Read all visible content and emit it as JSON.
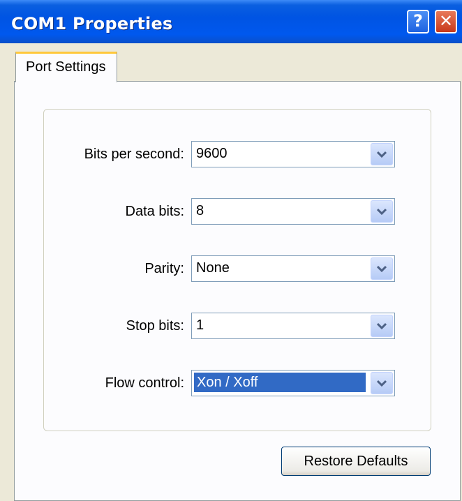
{
  "window": {
    "title": "COM1 Properties",
    "help_label": "?",
    "close_label": "✕"
  },
  "tabs": [
    {
      "label": "Port Settings"
    }
  ],
  "fields": [
    {
      "label": "Bits per second:",
      "value": "9600"
    },
    {
      "label": "Data bits:",
      "value": "8"
    },
    {
      "label": "Parity:",
      "value": "None"
    },
    {
      "label": "Stop bits:",
      "value": "1"
    },
    {
      "label": "Flow control:",
      "value": "Xon / Xoff",
      "selected": true
    }
  ],
  "buttons": {
    "restore_defaults": "Restore Defaults"
  },
  "icons": {
    "help": "help-icon",
    "close": "close-icon",
    "dropdown": "chevron-down-icon"
  }
}
